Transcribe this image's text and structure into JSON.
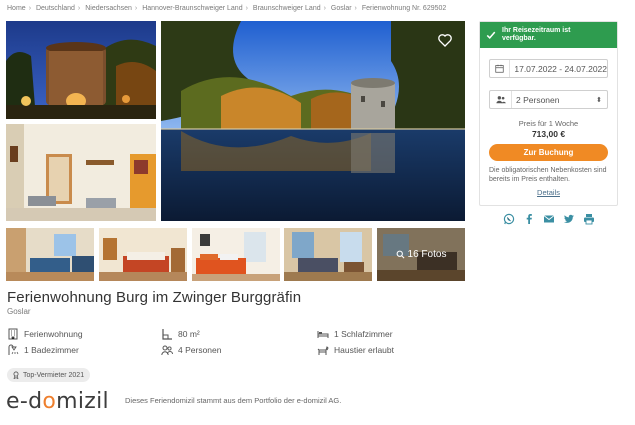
{
  "breadcrumb": [
    "Home",
    "Deutschland",
    "Niedersachsen",
    "Hannover-Braunschweiger Land",
    "Braunschweiger Land",
    "Goslar",
    "Ferienwohnung Nr. 629502"
  ],
  "gallery": {
    "more_photos_label": "16 Fotos"
  },
  "listing": {
    "title": "Ferienwohnung Burg im Zwinger Burggräfin",
    "location": "Goslar",
    "features": [
      {
        "icon": "building-icon",
        "label": "Ferienwohnung"
      },
      {
        "icon": "floor-area-icon",
        "label": "80 m²"
      },
      {
        "icon": "bed-icon",
        "label": "1 Schlafzimmer"
      },
      {
        "icon": "shower-icon",
        "label": "1 Badezimmer"
      },
      {
        "icon": "people-icon",
        "label": "4 Personen"
      },
      {
        "icon": "pet-icon",
        "label": "Haustier erlaubt"
      }
    ],
    "badge": "Top-Vermieter 2021"
  },
  "provider": {
    "logo_text": "e-domizil",
    "note": "Dieses Feriendomizil stammt aus dem Portfolio der e-domizil AG."
  },
  "booking": {
    "availability": "Ihr Reisezeitraum ist verfügbar.",
    "dates": "17.07.2022 - 24.07.2022",
    "guests": "2 Personen",
    "price_label": "Preis für 1 Woche",
    "price": "713,00 €",
    "button": "Zur Buchung",
    "cost_note": "Die obligatorischen Nebenkosten sind bereits im Preis enthalten.",
    "details_link": "Details"
  },
  "share_icons": [
    "whatsapp-icon",
    "facebook-icon",
    "email-icon",
    "twitter-icon",
    "print-icon"
  ],
  "colors": {
    "available_green": "#2e9c4f",
    "book_orange": "#f08a24",
    "brand_orange": "#ee7f2d",
    "share_teal": "#3b8fa3"
  }
}
